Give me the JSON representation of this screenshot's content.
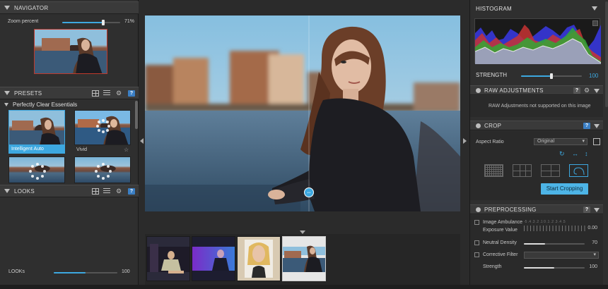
{
  "navigator": {
    "title": "NAVIGATOR",
    "zoom_label": "Zoom percent",
    "zoom_value": "71%",
    "zoom_fraction": 0.71
  },
  "presets": {
    "title": "PRESETS",
    "group_label": "Perfectly Clear Essentials",
    "items": [
      {
        "label": "Intelligent Auto",
        "selected": true
      },
      {
        "label": "Vivid",
        "selected": false
      }
    ]
  },
  "looks": {
    "title": "LOOKS",
    "slider_label": "LOOKs",
    "slider_value": "100",
    "slider_fraction": 0.5
  },
  "histogram": {
    "title": "HISTOGRAM"
  },
  "strength": {
    "label": "STRENGTH",
    "value": "100",
    "fraction": 0.5
  },
  "raw": {
    "title": "RAW ADJUSTMENTS",
    "message": "RAW Adjustments not supported on this image"
  },
  "crop": {
    "title": "CROP",
    "aspect_label": "Aspect Ratio",
    "aspect_value": "Original",
    "button": "Start Cropping"
  },
  "preprocessing": {
    "title": "PREPROCESSING",
    "ambulance_label": "Image Ambulance",
    "exposure_label": "Exposure Value",
    "exposure_scale": "-5 .4 .3 .2 .1 0 .1 .2 .3 .4 .5",
    "exposure_value": "0.00",
    "neutral_label": "Neutral Density",
    "neutral_value": "70",
    "neutral_fraction": 0.35,
    "corrective_label": "Corrective Filter",
    "strength_label": "Strength",
    "strength_value": "100",
    "strength_fraction": 0.5
  },
  "colors": {
    "accent": "#3da8e0",
    "button": "#4db4e6",
    "help": "#3b7fc4"
  }
}
